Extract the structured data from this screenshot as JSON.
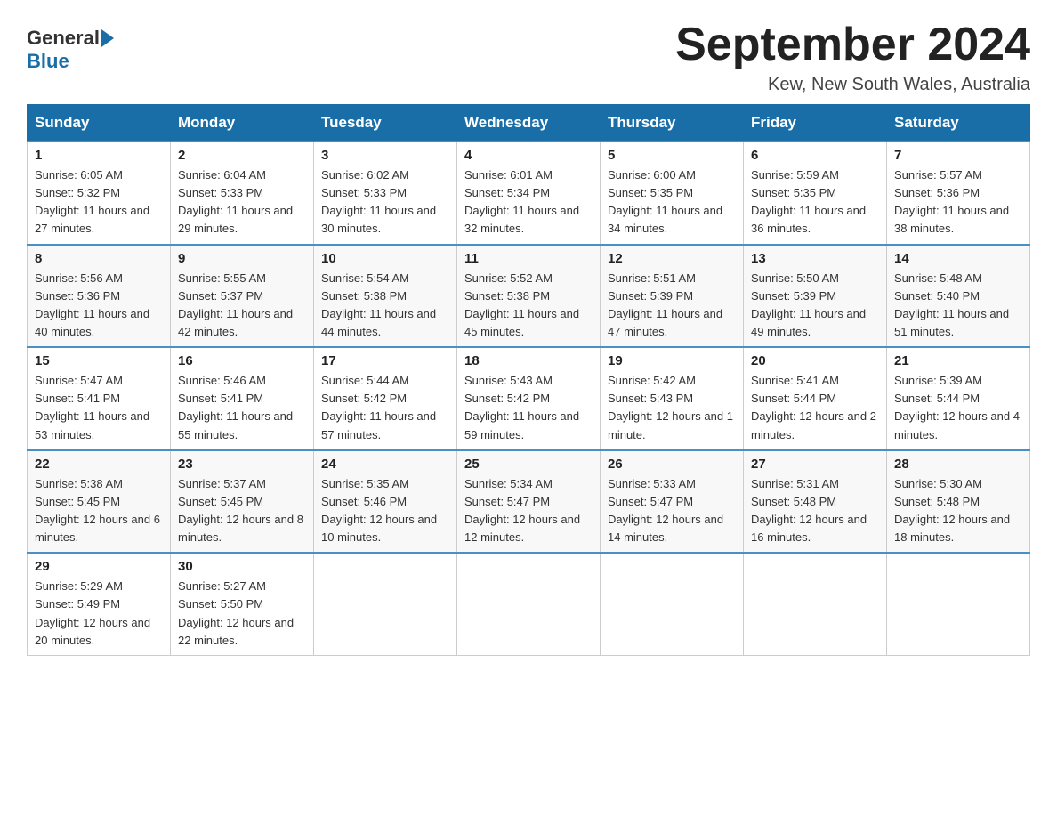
{
  "header": {
    "logo_general": "General",
    "logo_blue": "Blue",
    "main_title": "September 2024",
    "subtitle": "Kew, New South Wales, Australia"
  },
  "days_of_week": [
    "Sunday",
    "Monday",
    "Tuesday",
    "Wednesday",
    "Thursday",
    "Friday",
    "Saturday"
  ],
  "weeks": [
    [
      {
        "day": "1",
        "sunrise": "6:05 AM",
        "sunset": "5:32 PM",
        "daylight": "11 hours and 27 minutes."
      },
      {
        "day": "2",
        "sunrise": "6:04 AM",
        "sunset": "5:33 PM",
        "daylight": "11 hours and 29 minutes."
      },
      {
        "day": "3",
        "sunrise": "6:02 AM",
        "sunset": "5:33 PM",
        "daylight": "11 hours and 30 minutes."
      },
      {
        "day": "4",
        "sunrise": "6:01 AM",
        "sunset": "5:34 PM",
        "daylight": "11 hours and 32 minutes."
      },
      {
        "day": "5",
        "sunrise": "6:00 AM",
        "sunset": "5:35 PM",
        "daylight": "11 hours and 34 minutes."
      },
      {
        "day": "6",
        "sunrise": "5:59 AM",
        "sunset": "5:35 PM",
        "daylight": "11 hours and 36 minutes."
      },
      {
        "day": "7",
        "sunrise": "5:57 AM",
        "sunset": "5:36 PM",
        "daylight": "11 hours and 38 minutes."
      }
    ],
    [
      {
        "day": "8",
        "sunrise": "5:56 AM",
        "sunset": "5:36 PM",
        "daylight": "11 hours and 40 minutes."
      },
      {
        "day": "9",
        "sunrise": "5:55 AM",
        "sunset": "5:37 PM",
        "daylight": "11 hours and 42 minutes."
      },
      {
        "day": "10",
        "sunrise": "5:54 AM",
        "sunset": "5:38 PM",
        "daylight": "11 hours and 44 minutes."
      },
      {
        "day": "11",
        "sunrise": "5:52 AM",
        "sunset": "5:38 PM",
        "daylight": "11 hours and 45 minutes."
      },
      {
        "day": "12",
        "sunrise": "5:51 AM",
        "sunset": "5:39 PM",
        "daylight": "11 hours and 47 minutes."
      },
      {
        "day": "13",
        "sunrise": "5:50 AM",
        "sunset": "5:39 PM",
        "daylight": "11 hours and 49 minutes."
      },
      {
        "day": "14",
        "sunrise": "5:48 AM",
        "sunset": "5:40 PM",
        "daylight": "11 hours and 51 minutes."
      }
    ],
    [
      {
        "day": "15",
        "sunrise": "5:47 AM",
        "sunset": "5:41 PM",
        "daylight": "11 hours and 53 minutes."
      },
      {
        "day": "16",
        "sunrise": "5:46 AM",
        "sunset": "5:41 PM",
        "daylight": "11 hours and 55 minutes."
      },
      {
        "day": "17",
        "sunrise": "5:44 AM",
        "sunset": "5:42 PM",
        "daylight": "11 hours and 57 minutes."
      },
      {
        "day": "18",
        "sunrise": "5:43 AM",
        "sunset": "5:42 PM",
        "daylight": "11 hours and 59 minutes."
      },
      {
        "day": "19",
        "sunrise": "5:42 AM",
        "sunset": "5:43 PM",
        "daylight": "12 hours and 1 minute."
      },
      {
        "day": "20",
        "sunrise": "5:41 AM",
        "sunset": "5:44 PM",
        "daylight": "12 hours and 2 minutes."
      },
      {
        "day": "21",
        "sunrise": "5:39 AM",
        "sunset": "5:44 PM",
        "daylight": "12 hours and 4 minutes."
      }
    ],
    [
      {
        "day": "22",
        "sunrise": "5:38 AM",
        "sunset": "5:45 PM",
        "daylight": "12 hours and 6 minutes."
      },
      {
        "day": "23",
        "sunrise": "5:37 AM",
        "sunset": "5:45 PM",
        "daylight": "12 hours and 8 minutes."
      },
      {
        "day": "24",
        "sunrise": "5:35 AM",
        "sunset": "5:46 PM",
        "daylight": "12 hours and 10 minutes."
      },
      {
        "day": "25",
        "sunrise": "5:34 AM",
        "sunset": "5:47 PM",
        "daylight": "12 hours and 12 minutes."
      },
      {
        "day": "26",
        "sunrise": "5:33 AM",
        "sunset": "5:47 PM",
        "daylight": "12 hours and 14 minutes."
      },
      {
        "day": "27",
        "sunrise": "5:31 AM",
        "sunset": "5:48 PM",
        "daylight": "12 hours and 16 minutes."
      },
      {
        "day": "28",
        "sunrise": "5:30 AM",
        "sunset": "5:48 PM",
        "daylight": "12 hours and 18 minutes."
      }
    ],
    [
      {
        "day": "29",
        "sunrise": "5:29 AM",
        "sunset": "5:49 PM",
        "daylight": "12 hours and 20 minutes."
      },
      {
        "day": "30",
        "sunrise": "5:27 AM",
        "sunset": "5:50 PM",
        "daylight": "12 hours and 22 minutes."
      },
      null,
      null,
      null,
      null,
      null
    ]
  ],
  "labels": {
    "sunrise_prefix": "Sunrise: ",
    "sunset_prefix": "Sunset: ",
    "daylight_prefix": "Daylight: "
  }
}
